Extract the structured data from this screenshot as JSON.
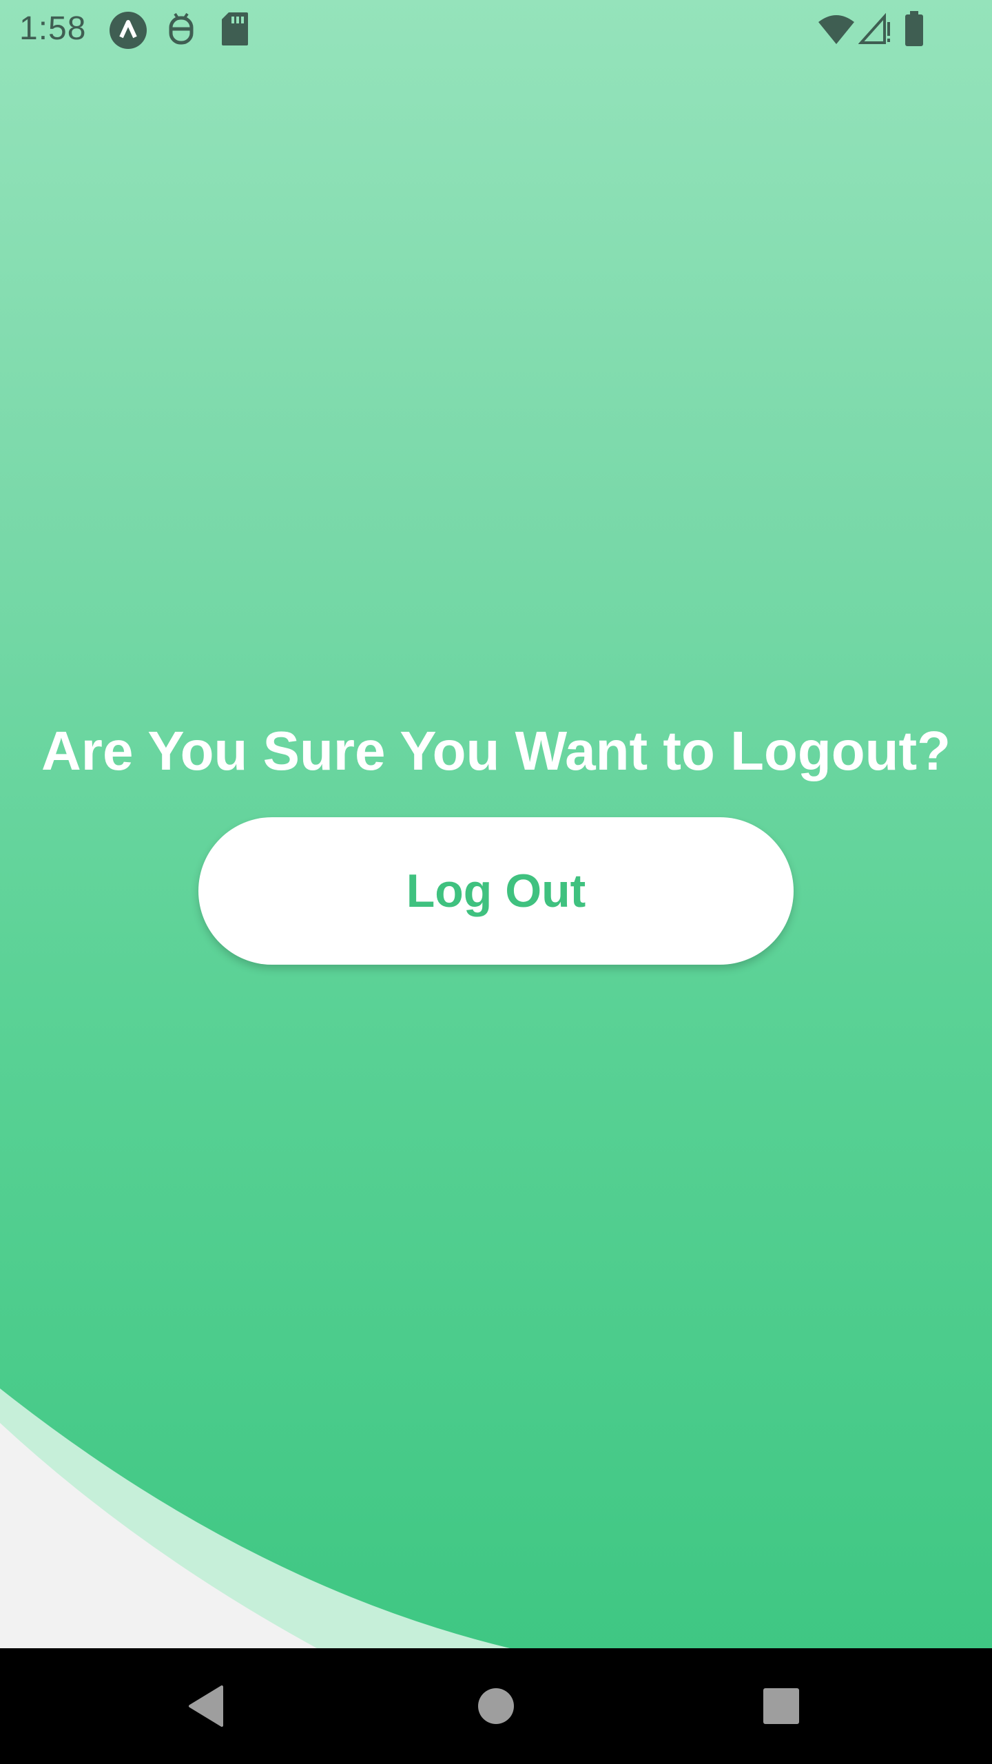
{
  "status_bar": {
    "time": "1:58",
    "icons": [
      "app-a-icon",
      "debug-icon",
      "sd-card-icon",
      "wifi-icon",
      "signal-icon",
      "battery-icon"
    ]
  },
  "logout_screen": {
    "title": "Are You Sure You Want to Logout?",
    "button_label": "Log Out"
  },
  "nav_bar": {
    "buttons": [
      "back-icon",
      "home-icon",
      "recents-icon"
    ]
  },
  "colors": {
    "gradient_top": "#95e3bb",
    "gradient_bottom": "#3fc783",
    "button_background": "#ffffff",
    "button_text": "#3fc17f",
    "status_icons": "#3f5e52",
    "nav_bar": "#000000",
    "nav_icons": "#9e9e9e"
  }
}
